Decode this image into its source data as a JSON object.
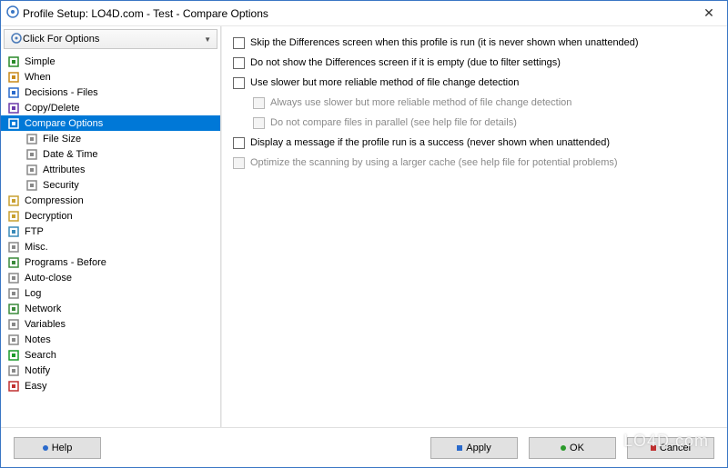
{
  "window": {
    "title": "Profile Setup: LO4D.com - Test - Compare Options"
  },
  "sidebar": {
    "header": "Click For Options",
    "items": [
      {
        "label": "Simple",
        "icon": "simple-icon",
        "color": "#2a8a2a"
      },
      {
        "label": "When",
        "icon": "clock-icon",
        "color": "#c88a1a"
      },
      {
        "label": "Decisions - Files",
        "icon": "decision-icon",
        "color": "#2a6acc"
      },
      {
        "label": "Copy/Delete",
        "icon": "copy-icon",
        "color": "#6a3aaa"
      },
      {
        "label": "Compare Options",
        "icon": "compare-icon",
        "color": "#ffffff",
        "selected": true
      },
      {
        "label": "File Size",
        "icon": "filesize-icon",
        "color": "#888",
        "sub": true
      },
      {
        "label": "Date & Time",
        "icon": "datetime-icon",
        "color": "#888",
        "sub": true
      },
      {
        "label": "Attributes",
        "icon": "attributes-icon",
        "color": "#888",
        "sub": true
      },
      {
        "label": "Security",
        "icon": "security-icon",
        "color": "#888",
        "sub": true
      },
      {
        "label": "Compression",
        "icon": "compression-icon",
        "color": "#c8a030"
      },
      {
        "label": "Decryption",
        "icon": "decryption-icon",
        "color": "#c8a030"
      },
      {
        "label": "FTP",
        "icon": "ftp-icon",
        "color": "#3a8ab8"
      },
      {
        "label": "Misc.",
        "icon": "misc-icon",
        "color": "#888"
      },
      {
        "label": "Programs - Before",
        "icon": "programs-icon",
        "color": "#3a8a3a"
      },
      {
        "label": "Auto-close",
        "icon": "autoclose-icon",
        "color": "#888"
      },
      {
        "label": "Log",
        "icon": "log-icon",
        "color": "#888"
      },
      {
        "label": "Network",
        "icon": "network-icon",
        "color": "#3a8a3a"
      },
      {
        "label": "Variables",
        "icon": "variables-icon",
        "color": "#888"
      },
      {
        "label": "Notes",
        "icon": "notes-icon",
        "color": "#888"
      },
      {
        "label": "Search",
        "icon": "search-icon",
        "color": "#1a9a2a"
      },
      {
        "label": "Notify",
        "icon": "notify-icon",
        "color": "#888"
      },
      {
        "label": "Easy",
        "icon": "easy-icon",
        "color": "#c03030"
      }
    ]
  },
  "options": [
    {
      "label": "Skip the Differences screen when this profile is run (it is never shown when unattended)",
      "checked": false,
      "enabled": true,
      "sub": false
    },
    {
      "label": "Do not show the Differences screen if it is empty (due to filter settings)",
      "checked": false,
      "enabled": true,
      "sub": false
    },
    {
      "label": "Use slower but more reliable method of file change detection",
      "checked": false,
      "enabled": true,
      "sub": false
    },
    {
      "label": "Always use slower but more reliable method of file change detection",
      "checked": false,
      "enabled": false,
      "sub": true
    },
    {
      "label": "Do not compare files in parallel (see help file for details)",
      "checked": false,
      "enabled": false,
      "sub": true
    },
    {
      "label": "Display a message if the profile run is a success (never shown when unattended)",
      "checked": false,
      "enabled": true,
      "sub": false
    },
    {
      "label": "Optimize the scanning by using a larger cache (see help file for potential problems)",
      "checked": false,
      "enabled": false,
      "sub": false
    }
  ],
  "footer": {
    "help": "Help",
    "apply": "Apply",
    "ok": "OK",
    "cancel": "Cancel"
  },
  "watermark": "LO4D.com"
}
